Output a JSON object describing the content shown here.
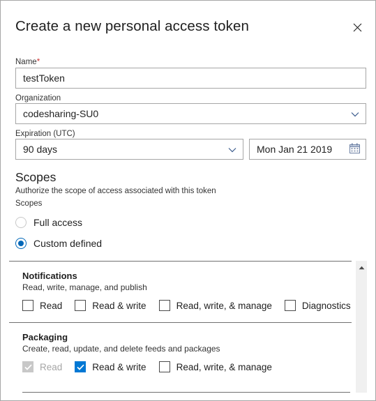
{
  "dialog": {
    "title": "Create a new personal access token",
    "close_icon": "close-icon"
  },
  "form": {
    "name": {
      "label": "Name",
      "required_mark": "*",
      "value": "testToken",
      "placeholder": ""
    },
    "organization": {
      "label": "Organization",
      "value": "codesharing-SU0",
      "chevron_icon": "chevron-down-icon"
    },
    "expiration": {
      "label": "Expiration (UTC)",
      "duration_value": "90 days",
      "chevron_icon": "chevron-down-icon",
      "date_value": "Mon Jan 21 2019",
      "calendar_icon": "calendar-icon"
    }
  },
  "scopes": {
    "heading": "Scopes",
    "subtitle": "Authorize the scope of access associated with this token",
    "mini_label": "Scopes",
    "radios": [
      {
        "label": "Full access",
        "checked": false
      },
      {
        "label": "Custom defined",
        "checked": true
      }
    ],
    "groups": [
      {
        "title": "Notifications",
        "description": "Read, write, manage, and publish",
        "options": [
          {
            "label": "Read",
            "checked": false,
            "disabled": false
          },
          {
            "label": "Read & write",
            "checked": false,
            "disabled": false
          },
          {
            "label": "Read, write, & manage",
            "checked": false,
            "disabled": false
          },
          {
            "label": "Diagnostics",
            "checked": false,
            "disabled": false
          }
        ]
      },
      {
        "title": "Packaging",
        "description": "Create, read, update, and delete feeds and packages",
        "options": [
          {
            "label": "Read",
            "checked": true,
            "disabled": true
          },
          {
            "label": "Read & write",
            "checked": true,
            "disabled": false
          },
          {
            "label": "Read, write, & manage",
            "checked": false,
            "disabled": false
          }
        ]
      }
    ],
    "scrollbar": {
      "up_arrow_icon": "scroll-up-arrow-icon"
    }
  },
  "colors": {
    "accent": "#0078d4",
    "radio_accent": "#0067b8",
    "disabled": "#c8c8c8",
    "required": "#cc3333"
  }
}
